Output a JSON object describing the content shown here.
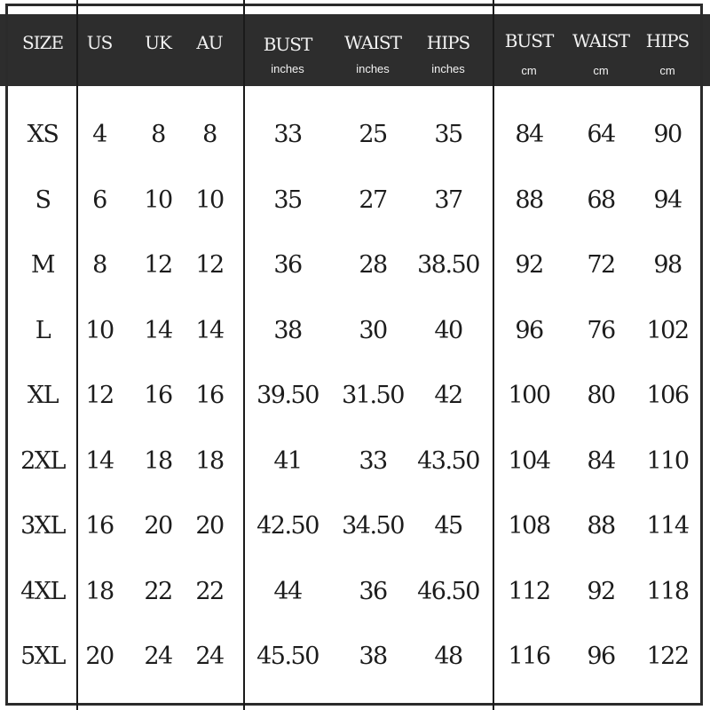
{
  "table": {
    "headers": {
      "size": "SIZE",
      "us": "US",
      "uk": "UK",
      "au": "AU",
      "bust_in": "BUST",
      "waist_in": "WAIST",
      "hips_in": "HIPS",
      "bust_cm": "BUST",
      "waist_cm": "WAIST",
      "hips_cm": "HIPS"
    },
    "units": {
      "bust_in": "inches",
      "waist_in": "inches",
      "hips_in": "inches",
      "bust_cm": "cm",
      "waist_cm": "cm",
      "hips_cm": "cm"
    },
    "rows": [
      {
        "size": "XS",
        "us": "4",
        "uk": "8",
        "au": "8",
        "bust_in": "33",
        "waist_in": "25",
        "hips_in": "35",
        "bust_cm": "84",
        "waist_cm": "64",
        "hips_cm": "90"
      },
      {
        "size": "S",
        "us": "6",
        "uk": "10",
        "au": "10",
        "bust_in": "35",
        "waist_in": "27",
        "hips_in": "37",
        "bust_cm": "88",
        "waist_cm": "68",
        "hips_cm": "94"
      },
      {
        "size": "M",
        "us": "8",
        "uk": "12",
        "au": "12",
        "bust_in": "36",
        "waist_in": "28",
        "hips_in": "38.50",
        "bust_cm": "92",
        "waist_cm": "72",
        "hips_cm": "98"
      },
      {
        "size": "L",
        "us": "10",
        "uk": "14",
        "au": "14",
        "bust_in": "38",
        "waist_in": "30",
        "hips_in": "40",
        "bust_cm": "96",
        "waist_cm": "76",
        "hips_cm": "102"
      },
      {
        "size": "XL",
        "us": "12",
        "uk": "16",
        "au": "16",
        "bust_in": "39.50",
        "waist_in": "31.50",
        "hips_in": "42",
        "bust_cm": "100",
        "waist_cm": "80",
        "hips_cm": "106"
      },
      {
        "size": "2XL",
        "us": "14",
        "uk": "18",
        "au": "18",
        "bust_in": "41",
        "waist_in": "33",
        "hips_in": "43.50",
        "bust_cm": "104",
        "waist_cm": "84",
        "hips_cm": "110"
      },
      {
        "size": "3XL",
        "us": "16",
        "uk": "20",
        "au": "20",
        "bust_in": "42.50",
        "waist_in": "34.50",
        "hips_in": "45",
        "bust_cm": "108",
        "waist_cm": "88",
        "hips_cm": "114"
      },
      {
        "size": "4XL",
        "us": "18",
        "uk": "22",
        "au": "22",
        "bust_in": "44",
        "waist_in": "36",
        "hips_in": "46.50",
        "bust_cm": "112",
        "waist_cm": "92",
        "hips_cm": "118"
      },
      {
        "size": "5XL",
        "us": "20",
        "uk": "24",
        "au": "24",
        "bust_in": "45.50",
        "waist_in": "38",
        "hips_in": "48",
        "bust_cm": "116",
        "waist_cm": "96",
        "hips_cm": "122"
      }
    ]
  },
  "colors": {
    "header_bg": "#2d2d2d",
    "header_text": "#f2f2f2",
    "body_text": "#1c1c1c",
    "rule": "#1a1a1a"
  }
}
